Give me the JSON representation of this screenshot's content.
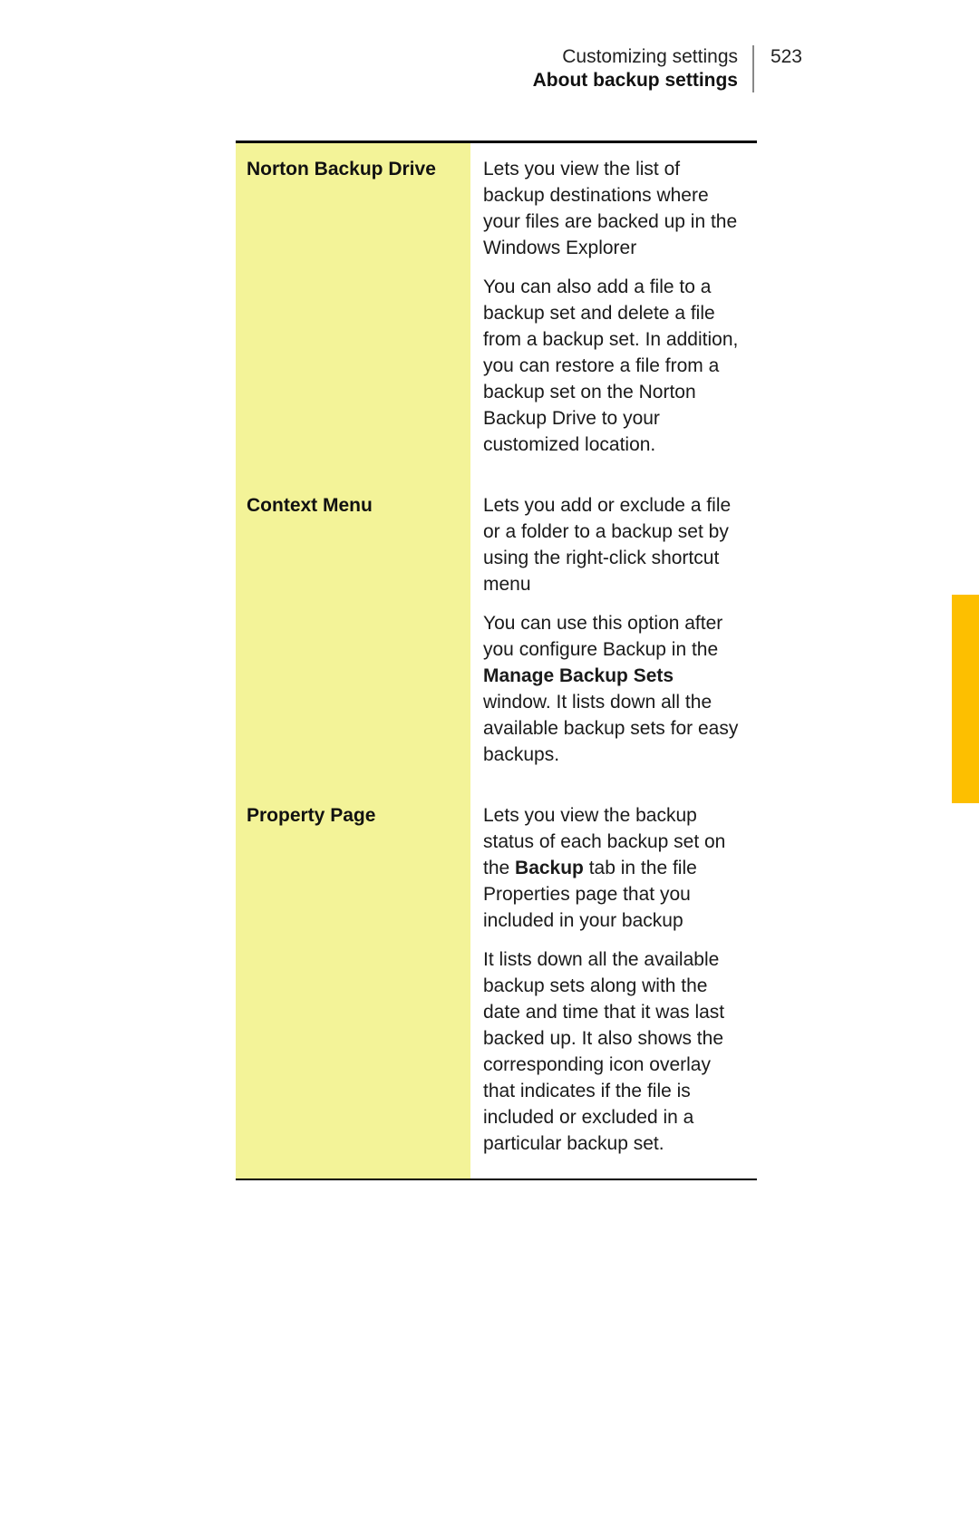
{
  "header": {
    "breadcrumb": "Customizing settings",
    "section_title": "About backup settings",
    "page_number": "523"
  },
  "rows": [
    {
      "label": "Norton Backup Drive",
      "desc": [
        {
          "parts": [
            {
              "t": "Lets you view the list of backup destinations where your files are backed up in the Windows Explorer",
              "b": false
            }
          ]
        },
        {
          "parts": [
            {
              "t": "You can also add a file to a backup set and delete a file from a backup set. In addition, you can restore a file from a backup set on the Norton Backup Drive to your customized location.",
              "b": false
            }
          ]
        }
      ]
    },
    {
      "label": "Context Menu",
      "desc": [
        {
          "parts": [
            {
              "t": "Lets you add or exclude a file or a folder to a backup set by using the right-click shortcut menu",
              "b": false
            }
          ]
        },
        {
          "parts": [
            {
              "t": "You can use this option after you configure Backup in the ",
              "b": false
            },
            {
              "t": "Manage Backup Sets",
              "b": true
            },
            {
              "t": " window. It lists down all the available backup sets for easy backups.",
              "b": false
            }
          ]
        }
      ]
    },
    {
      "label": "Property Page",
      "desc": [
        {
          "parts": [
            {
              "t": "Lets you view the backup status of each backup set on the ",
              "b": false
            },
            {
              "t": "Backup",
              "b": true
            },
            {
              "t": " tab in the file Properties page that you included in your backup",
              "b": false
            }
          ]
        },
        {
          "parts": [
            {
              "t": "It lists down all the available backup sets along with the date and time that it was last backed up. It also shows the corresponding icon overlay that indicates if the file is included or excluded in a particular backup set.",
              "b": false
            }
          ]
        }
      ]
    }
  ]
}
